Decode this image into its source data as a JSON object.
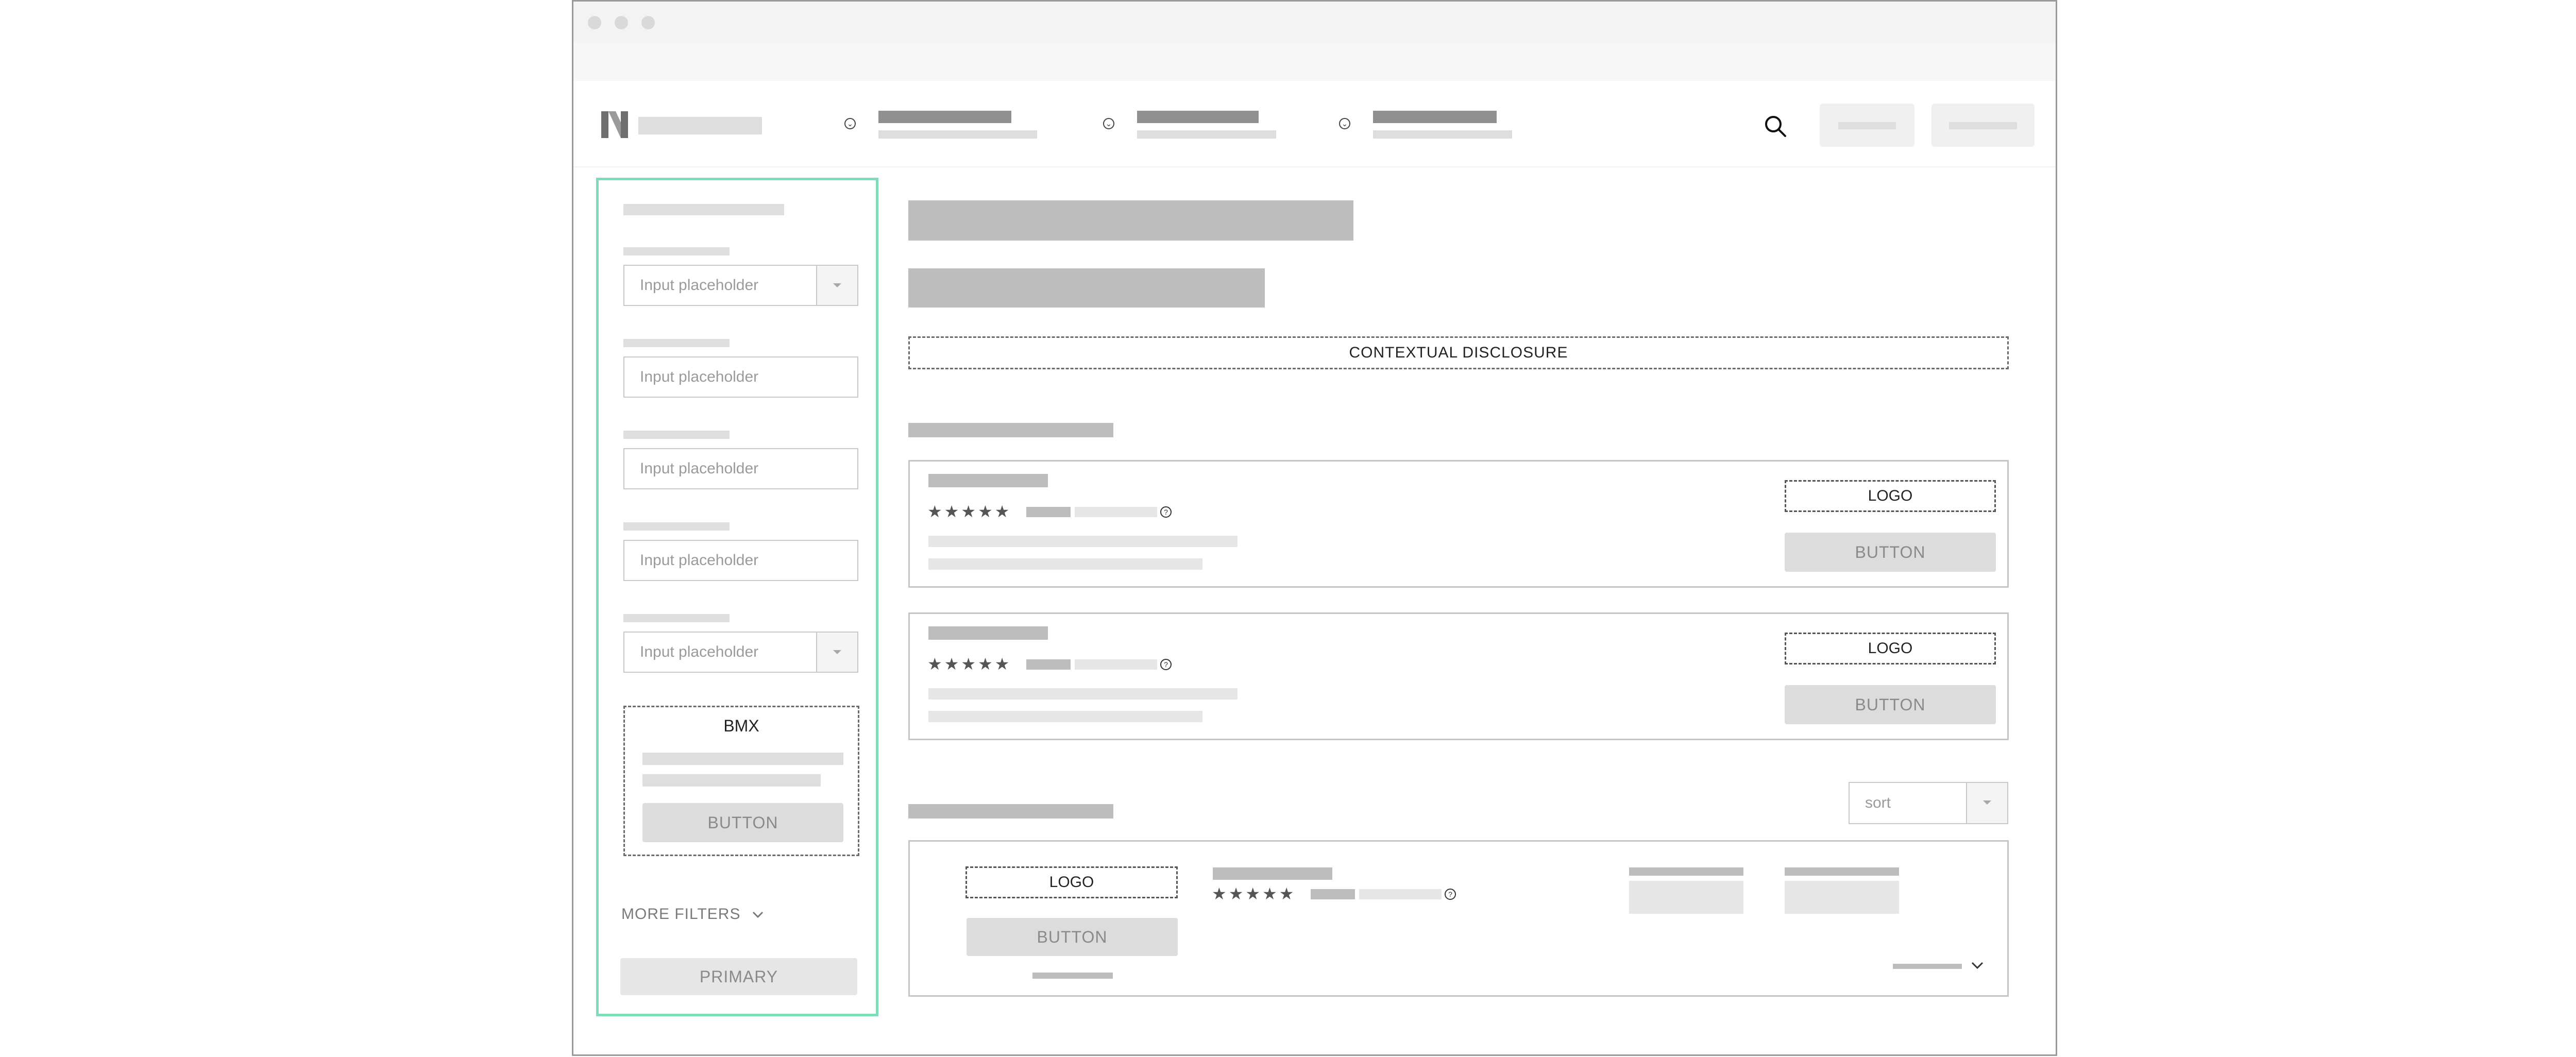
{
  "window": {
    "controls": [
      "close",
      "minimize",
      "maximize"
    ]
  },
  "nav": {
    "logo_icon": "n-logo-icon",
    "search_icon": "search-icon"
  },
  "sidebar": {
    "inputs": [
      {
        "placeholder": "Input placeholder",
        "type": "select"
      },
      {
        "placeholder": "Input placeholder",
        "type": "text"
      },
      {
        "placeholder": "Input placeholder",
        "type": "text"
      },
      {
        "placeholder": "Input placeholder",
        "type": "text"
      },
      {
        "placeholder": "Input placeholder",
        "type": "select"
      }
    ],
    "promo": {
      "title": "BMX",
      "button": "BUTTON"
    },
    "more_filters": "MORE FILTERS",
    "primary_button": "PRIMARY"
  },
  "main": {
    "disclosure": "CONTEXTUAL DISCLOSURE",
    "featured_cards": [
      {
        "stars": "★★★★★",
        "help": "?",
        "logo": "LOGO",
        "button": "BUTTON"
      },
      {
        "stars": "★★★★★",
        "help": "?",
        "logo": "LOGO",
        "button": "BUTTON"
      }
    ],
    "sort": {
      "placeholder": "sort"
    },
    "result_card": {
      "logo": "LOGO",
      "button": "BUTTON",
      "stars": "★★★★★",
      "help": "?"
    }
  }
}
